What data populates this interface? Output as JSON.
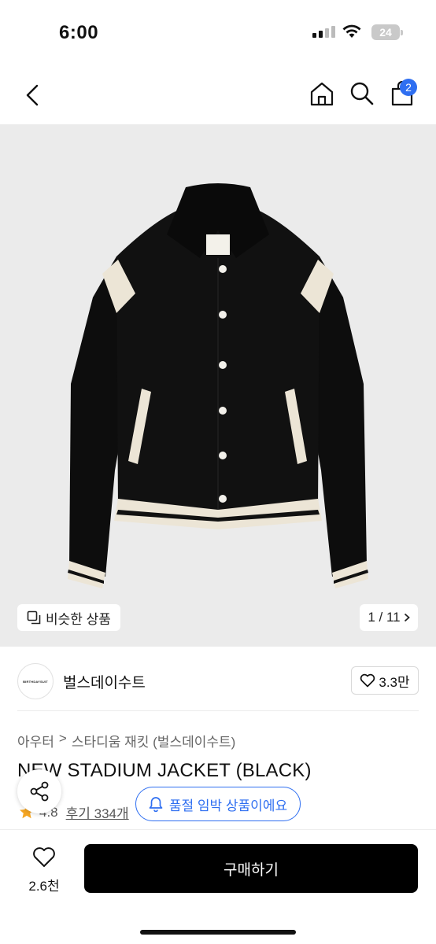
{
  "status_bar": {
    "time": "6:00",
    "battery": "24"
  },
  "nav": {
    "cart_count": "2"
  },
  "gallery": {
    "similar_label": "비슷한 상품",
    "counter": "1 / 11"
  },
  "brand": {
    "name": "벌스데이수트",
    "logo_text": "BIRTHDAYSUIT",
    "like_count": "3.3만"
  },
  "breadcrumb": {
    "category": "아우터",
    "separator": ">",
    "subcategory": "스타디움 재킷 (벌스데이수트)"
  },
  "product": {
    "title": "NEW STADIUM JACKET (BLACK)",
    "rating": "4.8",
    "reviews_label": "후기 334개",
    "stock_notice": "품절 임박 상품이에요"
  },
  "bottom_bar": {
    "likes": "2.6천",
    "buy_label": "구매하기"
  },
  "colors": {
    "accent": "#2f6ff1",
    "star": "#f5a623",
    "buy_button": "#000000"
  }
}
